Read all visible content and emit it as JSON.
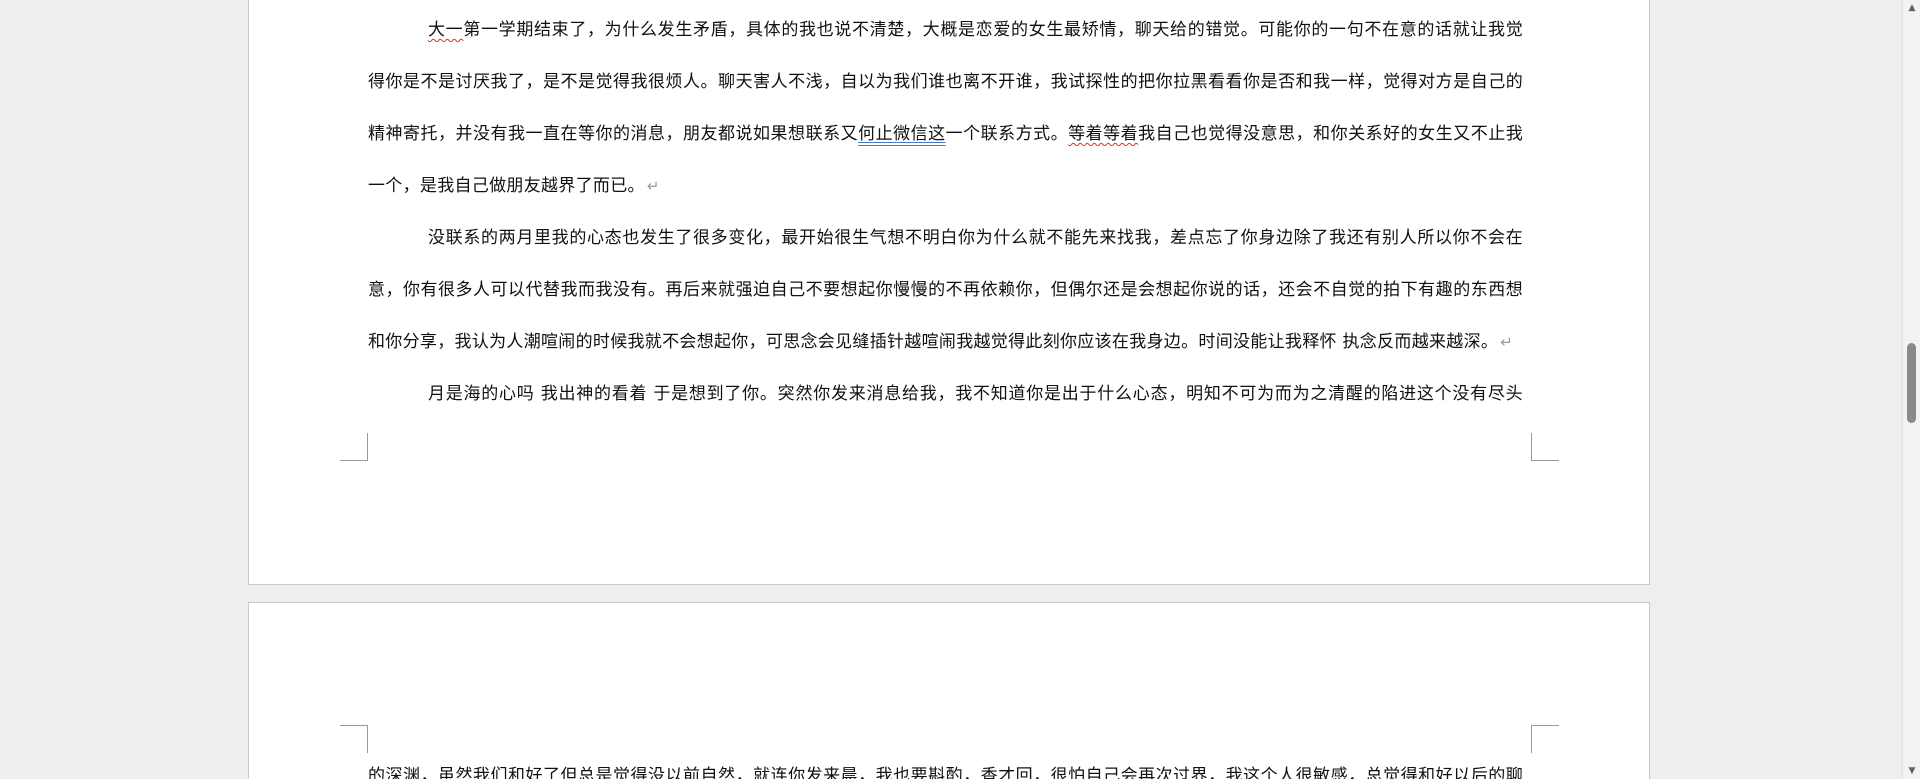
{
  "document": {
    "paragraphs": [
      {
        "lines": [
          [
            "",
            "大一",
            "第一学期结束了，为什么发生矛盾，具体的我也说不清楚，大概是恋爱的女生最矫情，聊天给的错觉。可能你的一句不在意的话就让我觉"
          ],
          [
            "得你是不是讨厌我了，是不是觉得我很烦人。聊天害人不浅，自以为我们谁也离不开谁，我试探性的把你拉黑看看你是否和我一样，觉得对方是自己的"
          ],
          [
            "精神寄托，并没有我一直在等你的消息，朋友都说如果想联系又",
            "何止微信这",
            "一个联系方式。",
            "等着等着",
            "我自己也觉得没意思，和你关系好的女生又不止我"
          ],
          [
            "一个，是我自己做朋友越界了而已。"
          ]
        ]
      },
      {
        "lines": [
          [
            "没联系的两月里我的心态也发生了很多变化，最开始很生气想不明白你为什么就不能先来找我，差点忘了你身边除了我还有别人所以你不会在"
          ],
          [
            "意，你有很多人可以代替我而我没有。再后来就强迫自己不要想起你慢慢的不再依赖你，但偶尔还是会想起你说的话，还会不自觉的拍下有趣的东西想"
          ],
          [
            "和你分享，我认为人潮喧闹的时候我就不会想起你，可思念会见缝插针越喧闹我越觉得此刻你应该在我身边。时间没能让我释怀  执念反而越来越深。"
          ]
        ]
      },
      {
        "lines": [
          [
            "月是海的心吗  我出神的看着  于是想到了你。突然你发来消息给我，我不知道你是出于什么心态，明知不可为而为之清醒的陷进这个没有尽头"
          ]
        ]
      }
    ],
    "page2_partial_line": "的深渊，虽然我们和好了但总是觉得没以前自然，就连你发来晨，我也要斟酌，香才回，很怕自己会再次过界，我这个人很敏感，总觉得和好以后的聊",
    "paragraph_mark": "↵"
  },
  "scrollbar": {
    "up_arrow": "▲",
    "down_arrow": "▼",
    "thumb_position_fraction": 0.49
  }
}
